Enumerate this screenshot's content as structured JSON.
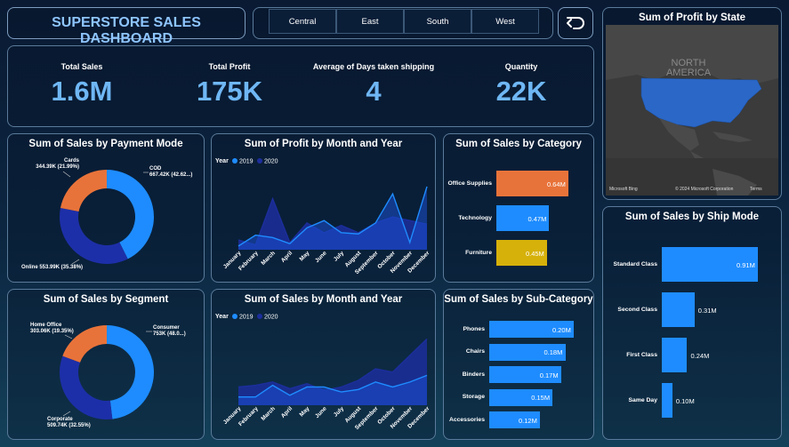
{
  "header": {
    "title": "SUPERSTORE SALES DASHBOARD"
  },
  "slicer": {
    "regions": [
      "Central",
      "East",
      "South",
      "West"
    ]
  },
  "back_button": {
    "icon": "back-arrow-icon"
  },
  "kpis": [
    {
      "label": "Total Sales",
      "value": "1.6M"
    },
    {
      "label": "Total Profit",
      "value": "175K"
    },
    {
      "label": "Average of Days taken shipping",
      "value": "4"
    },
    {
      "label": "Quantity",
      "value": "22K"
    }
  ],
  "map": {
    "title": "Sum of Profit by State",
    "region_label_1": "NORTH",
    "region_label_2": "AMERICA",
    "attribution_left": "Microsoft Bing",
    "attribution_right": "© 2024 Microsoft Corporation",
    "terms": "Terms"
  },
  "colors": {
    "accent": "#1e8cff",
    "orange": "#e8733a",
    "dark_blue": "#1d2fa8",
    "yellow": "#d6b10a",
    "line2019": "#1e8cff",
    "line2020": "#1c2e9c"
  },
  "chart_data": [
    {
      "id": "payment",
      "type": "pie",
      "title": "Sum of Sales by Payment Mode",
      "slices": [
        {
          "name": "COD",
          "value": 667.42,
          "label": "COD",
          "detail": "667.42K (42.62...)",
          "color": "#1e8cff"
        },
        {
          "name": "Online",
          "value": 553.99,
          "label": "Online 553.99K (35.38%)",
          "color": "#1d2fa8"
        },
        {
          "name": "Cards",
          "value": 344.39,
          "label": "Cards",
          "detail": "344.39K (21.99%)",
          "color": "#e8733a"
        }
      ]
    },
    {
      "id": "segment",
      "type": "pie",
      "title": "Sum of Sales by Segment",
      "slices": [
        {
          "name": "Consumer",
          "value": 753,
          "label": "Consumer",
          "detail": "753K (48.0...)",
          "color": "#1e8cff"
        },
        {
          "name": "Corporate",
          "value": 509.74,
          "label": "Corporate",
          "detail": "509.74K (32.55%)",
          "color": "#1d2fa8"
        },
        {
          "name": "Home Office",
          "value": 303.06,
          "label": "Home Office",
          "detail": "303.06K (19.35%)",
          "color": "#e8733a"
        }
      ]
    },
    {
      "id": "profit_month",
      "type": "area",
      "title": "Sum of Profit by Month and Year",
      "legend_title": "Year",
      "categories": [
        "January",
        "February",
        "March",
        "April",
        "May",
        "June",
        "July",
        "August",
        "September",
        "October",
        "November",
        "December"
      ],
      "series": [
        {
          "name": "2019",
          "values": [
            3,
            12,
            10,
            5,
            18,
            24,
            14,
            13,
            22,
            46,
            6,
            52
          ]
        },
        {
          "name": "2020",
          "values": [
            8,
            4,
            42,
            6,
            22,
            14,
            20,
            14,
            22,
            27,
            24,
            21
          ]
        }
      ],
      "ylim": [
        0,
        60
      ]
    },
    {
      "id": "sales_month",
      "type": "area",
      "title": "Sum of Sales by Month and Year",
      "legend_title": "Year",
      "categories": [
        "January",
        "February",
        "March",
        "April",
        "May",
        "June",
        "July",
        "August",
        "September",
        "October",
        "November",
        "December"
      ],
      "series": [
        {
          "name": "2019",
          "values": [
            10,
            10,
            24,
            12,
            22,
            22,
            16,
            19,
            28,
            22,
            28,
            36
          ]
        },
        {
          "name": "2020",
          "values": [
            22,
            24,
            28,
            20,
            26,
            18,
            22,
            30,
            44,
            40,
            60,
            80
          ]
        }
      ],
      "ylim": [
        0,
        90
      ]
    },
    {
      "id": "category",
      "type": "bar",
      "title": "Sum of Sales by Category",
      "categories": [
        "Office Supplies",
        "Technology",
        "Furniture"
      ],
      "values": [
        0.64,
        0.47,
        0.45
      ],
      "value_labels": [
        "0.64M",
        "0.47M",
        "0.45M"
      ],
      "colors": [
        "#e8733a",
        "#1e8cff",
        "#d6b10a"
      ]
    },
    {
      "id": "subcategory",
      "type": "bar",
      "title": "Sum of Sales by Sub-Category",
      "categories": [
        "Phones",
        "Chairs",
        "Binders",
        "Storage",
        "Accessories"
      ],
      "values": [
        0.2,
        0.18,
        0.17,
        0.15,
        0.12
      ],
      "value_labels": [
        "0.20M",
        "0.18M",
        "0.17M",
        "0.15M",
        "0.12M"
      ]
    },
    {
      "id": "shipmode",
      "type": "bar",
      "title": "Sum of Sales by Ship Mode",
      "categories": [
        "Standard Class",
        "Second Class",
        "First Class",
        "Same Day"
      ],
      "values": [
        0.91,
        0.31,
        0.24,
        0.1
      ],
      "value_labels": [
        "0.91M",
        "0.31M",
        "0.24M",
        "0.10M"
      ]
    }
  ]
}
